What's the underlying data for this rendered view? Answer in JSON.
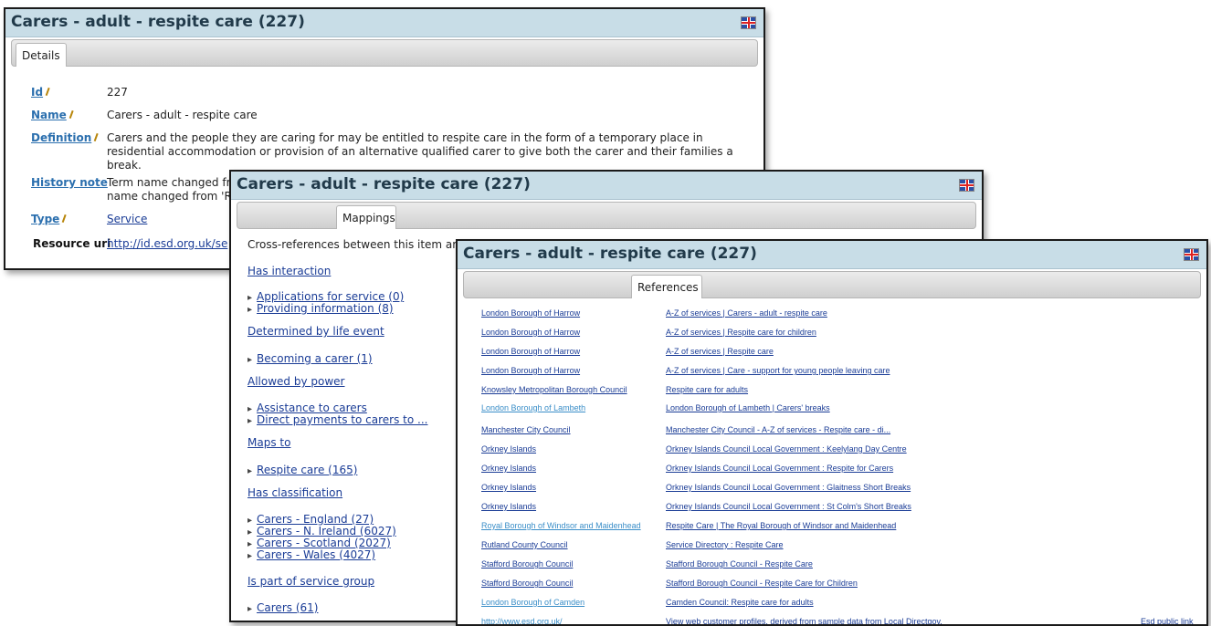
{
  "panel_details": {
    "title": "Carers - adult - respite care (227)",
    "tab": "Details",
    "rows": [
      {
        "label": "Id",
        "value": "227"
      },
      {
        "label": "Name",
        "value": "Carers - adult - respite care"
      },
      {
        "label": "Definition",
        "value": "Carers and the people they are caring for may be entitled to respite care in the form of a temporary place in residential accommodation or provision of an alternative qualified carer to give both the carer and their families a break."
      },
      {
        "label": "History note",
        "value": "Term name changed fr",
        "value2": "name changed from 'Re"
      },
      {
        "label": "Type",
        "value": "Service"
      },
      {
        "label": "Resource uri",
        "value": "http://id.esd.org.uk/se"
      }
    ]
  },
  "panel_mappings": {
    "title": "Carers - adult - respite care (227)",
    "tab": "Mappings",
    "intro": "Cross-references between this item ar",
    "sections": [
      {
        "heading": "Has interaction",
        "items": [
          "Applications for service (0)",
          "Providing information (8)"
        ]
      },
      {
        "heading": "Determined by life event",
        "items": [
          "Becoming a carer (1)"
        ]
      },
      {
        "heading": "Allowed by power",
        "items": [
          "Assistance to carers",
          "Direct payments to carers to ..."
        ]
      },
      {
        "heading": "Maps to",
        "items": [
          "Respite care (165)"
        ]
      },
      {
        "heading": "Has classification",
        "items": [
          "Carers - England (27)",
          "Carers - N. Ireland (6027)",
          "Carers - Scotland (2027)",
          "Carers - Wales (4027)"
        ]
      },
      {
        "heading": "Is part of service group",
        "items": [
          "Carers (61)"
        ]
      }
    ]
  },
  "panel_references": {
    "title": "Carers - adult - respite care (227)",
    "tab": "References",
    "rows": [
      {
        "org": "London Borough of Harrow",
        "ref": "A-Z of services | Carers - adult - respite care"
      },
      {
        "org": "London Borough of Harrow",
        "ref": "A-Z of services | Respite care for children"
      },
      {
        "org": "London Borough of Harrow",
        "ref": "A-Z of services | Respite care"
      },
      {
        "org": "London Borough of Harrow",
        "ref": "A-Z of services | Care - support for young people leaving care"
      },
      {
        "org": "Knowsley Metropolitan Borough Council",
        "ref": "Respite care for adults"
      },
      {
        "org": "London Borough of Lambeth",
        "ref": "London Borough of Lambeth | Carers' breaks",
        "light": true
      },
      {
        "org": "Manchester City Council",
        "ref": "Manchester City Council - A-Z of services - Respite care - di..."
      },
      {
        "org": "Orkney Islands",
        "ref": "Orkney Islands Council Local Government : Keelylang Day Centre"
      },
      {
        "org": "Orkney Islands",
        "ref": "Orkney Islands Council Local Government : Respite for Carers"
      },
      {
        "org": "Orkney Islands",
        "ref": "Orkney Islands Council Local Government : Glaitness Short Breaks"
      },
      {
        "org": "Orkney Islands",
        "ref": "Orkney Islands Council Local Government : St Colm's Short Breaks"
      },
      {
        "org": "Royal Borough of Windsor and Maidenhead",
        "ref": "Respite Care | The Royal Borough of Windsor and Maidenhead",
        "light": true
      },
      {
        "org": "Rutland County Council",
        "ref": "Service Directory : Respite Care"
      },
      {
        "org": "Stafford Borough Council",
        "ref": "Stafford Borough Council - Respite Care"
      },
      {
        "org": "Stafford Borough Council",
        "ref": "Stafford Borough Council - Respite Care for Children"
      },
      {
        "org": "London Borough of Camden",
        "ref": "Camden Council: Respite care for adults",
        "light": true
      },
      {
        "org": "http://www.esd.org.uk/",
        "ref": "View web customer profiles, derived from sample data from Local Directgov.",
        "extra": "Esd public link",
        "light": true
      }
    ]
  }
}
